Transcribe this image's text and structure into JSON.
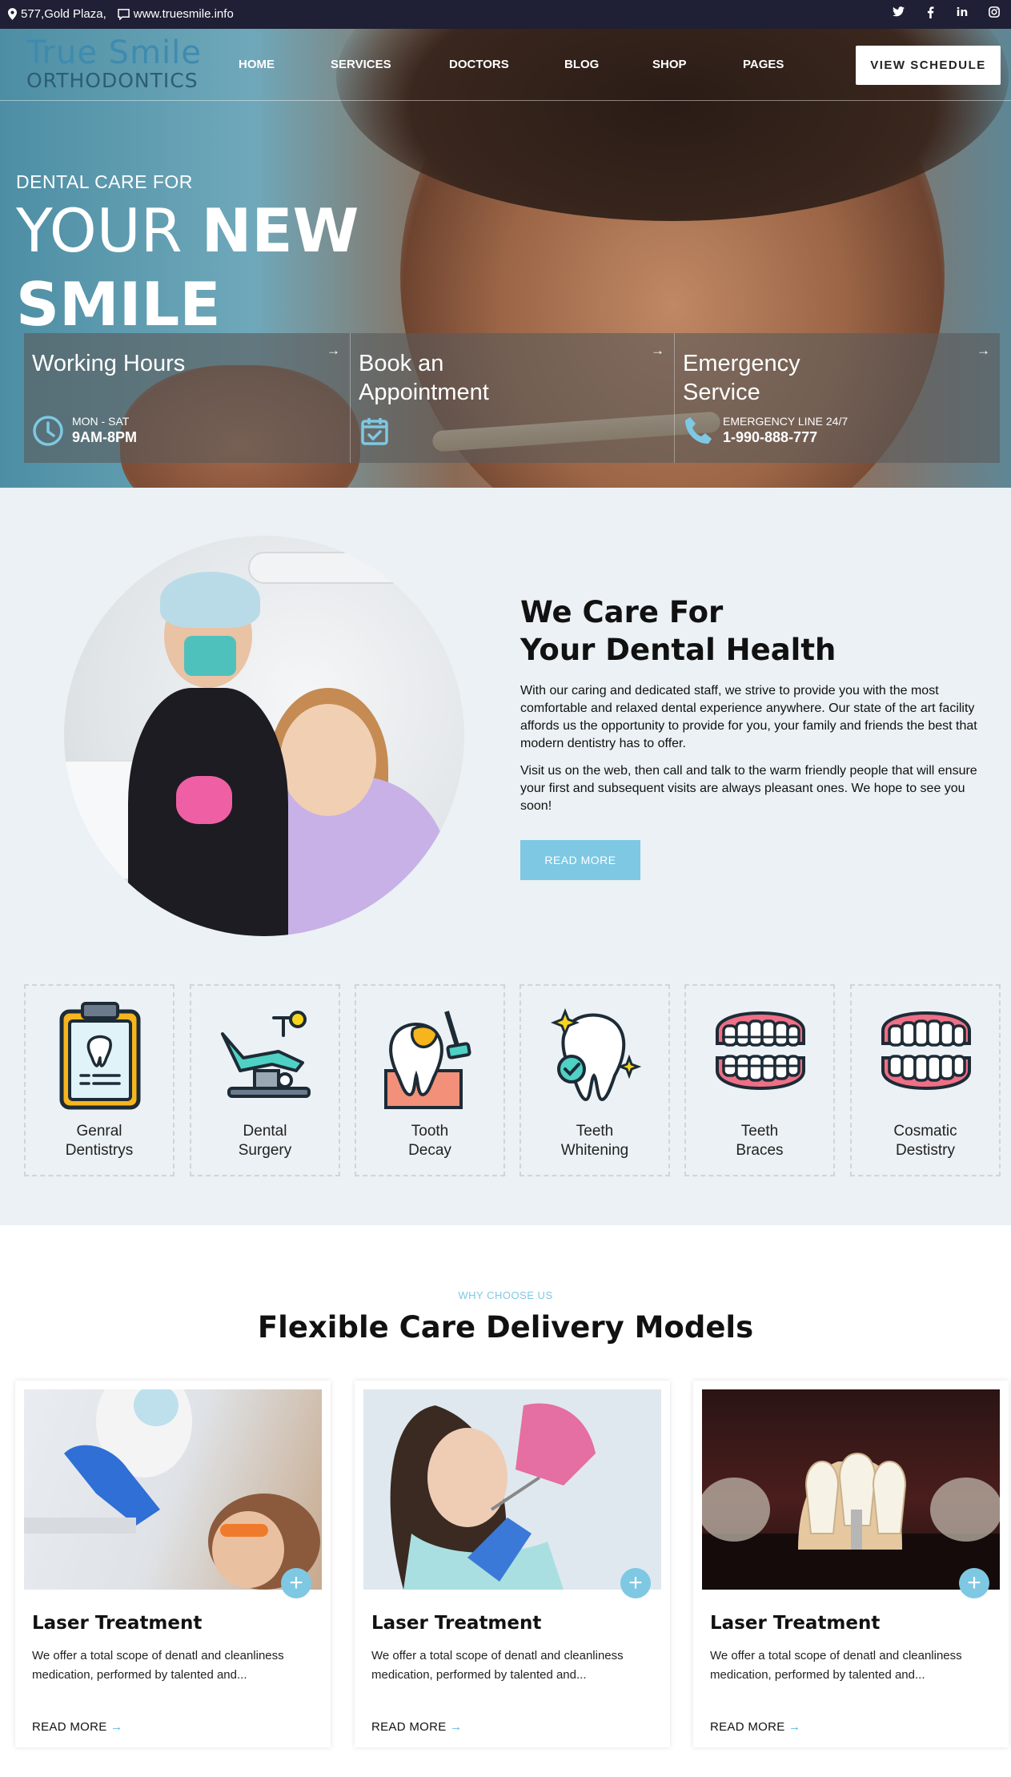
{
  "topbar": {
    "address": "577,Gold Plaza,",
    "website": "www.truesmile.info",
    "social": [
      "twitter-icon",
      "facebook-icon",
      "linkedin-icon",
      "instagram-icon"
    ]
  },
  "logo": {
    "line1": "True Smile",
    "line2": "ORTHODONTICS"
  },
  "nav": {
    "items": [
      "HOME",
      "SERVICES",
      "DOCTORS",
      "BLOG",
      "SHOP",
      "PAGES"
    ],
    "cta": "VIEW SCHEDULE"
  },
  "hero": {
    "subtitle": "DENTAL CARE FOR",
    "title_light": "YOUR",
    "title_bold_1": "NEW",
    "title_bold_2": "SMILE",
    "boxes": [
      {
        "title": "Working Hours",
        "icon": "clock-icon",
        "line1": "MON - SAT",
        "line2": "9AM-8PM"
      },
      {
        "title": "Book an Appointment",
        "icon": "calendar-icon",
        "line1": "",
        "line2": ""
      },
      {
        "title": "Emergency Service",
        "icon": "phone-icon",
        "line1": "EMERGENCY LINE 24/7",
        "line2": "1-990-888-777"
      }
    ]
  },
  "care": {
    "title_1": "We Care For",
    "title_2": "Your Dental Health",
    "p1": "With our caring and dedicated staff, we strive to provide you with the most comfortable and relaxed dental experience anywhere. Our state of the art facility affords us the opportunity to provide for you, your family and friends the best that modern dentistry has to offer.",
    "p2": "Visit us on the web, then call and talk to the warm friendly people that will ensure your first and subsequent visits are always pleasant ones. We hope to see you soon!",
    "button": "READ MORE"
  },
  "services": [
    {
      "line1": "Genral",
      "line2": "Dentistrys",
      "icon": "dental-xray-icon"
    },
    {
      "line1": "Dental",
      "line2": "Surgery",
      "icon": "dental-chair-icon"
    },
    {
      "line1": "Tooth",
      "line2": "Decay",
      "icon": "tooth-decay-icon"
    },
    {
      "line1": "Teeth",
      "line2": "Whitening",
      "icon": "tooth-whitening-icon"
    },
    {
      "line1": "Teeth",
      "line2": "Braces",
      "icon": "teeth-braces-icon"
    },
    {
      "line1": "Cosmatic",
      "line2": "Destistry",
      "icon": "denture-icon"
    }
  ],
  "why": {
    "eyebrow": "WHY CHOOSE US",
    "title": "Flexible Care Delivery Models",
    "cards": [
      {
        "title": "Laser Treatment",
        "desc": "We offer a total scope of denatl and cleanliness medication, performed by talented and...",
        "link": "READ MORE"
      },
      {
        "title": "Laser Treatment",
        "desc": "We offer a total scope of denatl and cleanliness medication, performed by talented and...",
        "link": "READ MORE"
      },
      {
        "title": "Laser Treatment",
        "desc": "We offer a total scope of denatl and cleanliness medication, performed by talented and...",
        "link": "READ MORE"
      }
    ]
  },
  "colors": {
    "accent": "#7ec8e3",
    "topbar": "#1f1f35",
    "section_bg": "#ebf1f4"
  }
}
